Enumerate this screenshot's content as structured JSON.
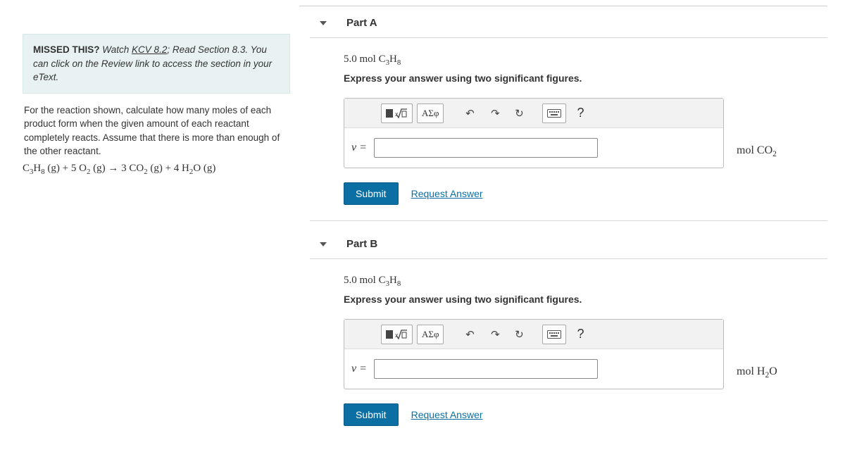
{
  "left": {
    "missed_bold": "MISSED THIS?",
    "missed_watch": " Watch ",
    "kcv_link": "KCV 8.2",
    "missed_rest": "; Read Section 8.3. You can click on the Review link to access the section in your eText.",
    "prompt": "For the reaction shown, calculate how many moles of each product form when the given amount of each reactant completely reacts. Assume that there is more than enough of the other reactant.",
    "equation_html": "C<sub>3</sub>H<sub>8</sub> (g) + 5 O<sub>2</sub> (g) → 3 CO<sub>2</sub> (g) + 4 H<sub>2</sub>O (g)"
  },
  "parts": {
    "A": {
      "title": "Part A",
      "amount_html": "5.0 mol C<sub>3</sub>H<sub>8</sub>",
      "instruction": "Express your answer using two significant figures.",
      "nu": "ν =",
      "unit_html": "mol CO<sub>2</sub>",
      "submit": "Submit",
      "request": "Request Answer"
    },
    "B": {
      "title": "Part B",
      "amount_html": "5.0 mol C<sub>3</sub>H<sub>8</sub>",
      "instruction": "Express your answer using two significant figures.",
      "nu": "ν =",
      "unit_html": "mol H<sub>2</sub>O",
      "submit": "Submit",
      "request": "Request Answer"
    }
  },
  "toolbar": {
    "greek": "ΑΣφ",
    "undo": "↶",
    "redo": "↷",
    "restart": "↻",
    "help": "?"
  }
}
